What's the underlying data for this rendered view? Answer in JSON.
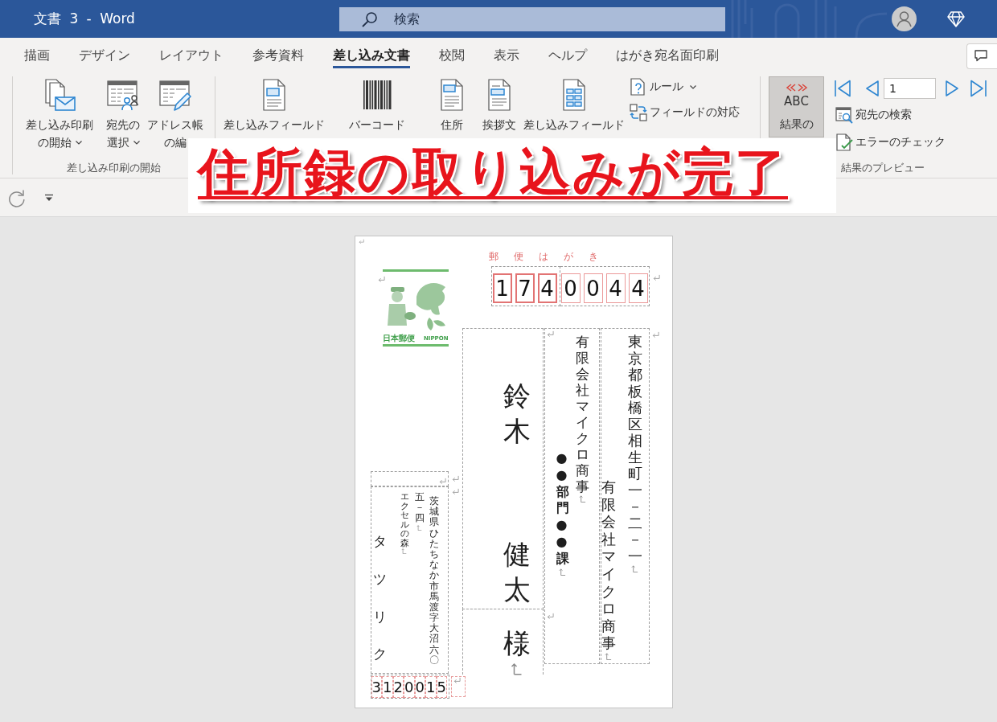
{
  "window": {
    "title": "文書 3 - Word",
    "search": {
      "placeholder": "検索"
    }
  },
  "tabs": [
    {
      "label": "描画",
      "selected": false
    },
    {
      "label": "デザイン",
      "selected": false
    },
    {
      "label": "レイアウト",
      "selected": false
    },
    {
      "label": "参考資料",
      "selected": false
    },
    {
      "label": "差し込み文書",
      "selected": true
    },
    {
      "label": "校閲",
      "selected": false
    },
    {
      "label": "表示",
      "selected": false
    },
    {
      "label": "ヘルプ",
      "selected": false
    },
    {
      "label": "はがき宛名面印刷",
      "selected": false
    }
  ],
  "ribbon": {
    "groups": [
      {
        "label": "差し込み印刷の開始",
        "large_buttons": [
          {
            "lines": [
              "差し込み印刷",
              "の開始"
            ],
            "has_menu": true
          },
          {
            "lines": [
              "宛先の",
              "選択"
            ],
            "has_menu": true
          },
          {
            "lines": [
              "アドレス帳",
              "の編"
            ],
            "has_menu": false
          }
        ]
      },
      {
        "large_buttons": [
          {
            "lines": [
              "差し込みフィールド"
            ],
            "has_menu": false
          },
          {
            "lines": [
              "バーコード"
            ],
            "has_menu": false
          },
          {
            "lines": [
              "住所"
            ],
            "has_menu": false
          },
          {
            "lines": [
              "挨拶文"
            ],
            "has_menu": false
          },
          {
            "lines": [
              "差し込みフィールド"
            ],
            "has_menu": false
          }
        ],
        "small_buttons": [
          {
            "label": "ルール",
            "has_menu": true
          },
          {
            "label": "フィールドの対応",
            "has_menu": false
          }
        ]
      },
      {
        "label": "結果のプレビュー",
        "large_buttons": [
          {
            "lines": [
              "結果の"
            ],
            "icon_text": "ABC",
            "pressed": true,
            "has_menu": false
          }
        ],
        "record_number": "1",
        "small_buttons": [
          {
            "label": "宛先の検索",
            "has_menu": false
          },
          {
            "label": "エラーのチェック",
            "has_menu": false
          }
        ]
      }
    ]
  },
  "annotation": {
    "text": "住所録の取り込みが完了"
  },
  "postcard": {
    "header": "郵便はがき",
    "recipient_postal_code": [
      "1",
      "7",
      "4",
      "0",
      "0",
      "4",
      "4"
    ],
    "stamp": {
      "name": "日本郵便",
      "country": "NIPPON"
    },
    "recipient_address": [
      "東京都板橋区相生町一－二－一",
      "有限会社マイクロ商事"
    ],
    "recipient_company": [
      "有限会社マイクロ商事",
      "●●部門●●課"
    ],
    "recipient_name": {
      "family": "鈴木",
      "given": "健太",
      "honorific": "様"
    },
    "sender_address": {
      "street": "茨城県ひたちなか市馬渡字大沼六〇",
      "house_number": "五－四"
    },
    "sender_company": "エクセルの森",
    "sender_name": "タツリク",
    "sender_postal_code": [
      "3",
      "1",
      "2",
      "0",
      "0",
      "1",
      "5"
    ]
  }
}
